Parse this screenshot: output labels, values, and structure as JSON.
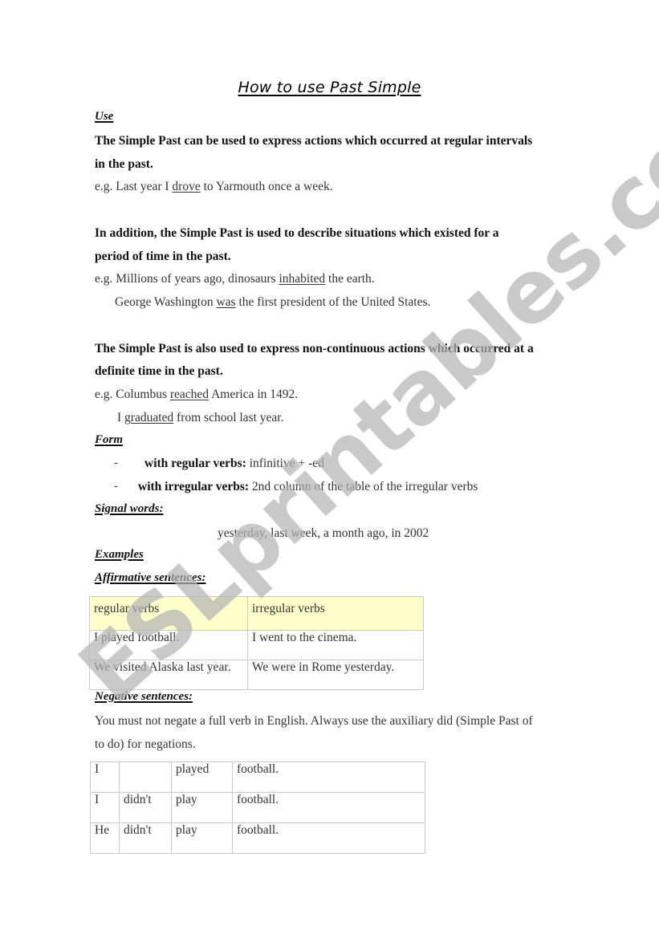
{
  "document": {
    "title": "How to use Past Simple",
    "sections": {
      "use": {
        "heading": "Use",
        "rule1": {
          "lines": [
            "The Simple Past can be used to express actions which occurred at regular intervals",
            "in the past."
          ],
          "example": {
            "prefix": "e.g. Last year I ",
            "verb": "drove",
            "suffix": " to Yarmouth once a week."
          }
        },
        "rule2": {
          "lines": [
            "In addition, the Simple Past is used to describe situations which existed for a",
            "period of time in the past."
          ],
          "examples": [
            {
              "prefix": "e.g. Millions of years ago, dinosaurs ",
              "verb": "inhabited",
              "suffix": " the earth."
            },
            {
              "prefix": "George Washington ",
              "verb": "was",
              "suffix": " the first president of the United States."
            }
          ]
        },
        "rule3": {
          "lines": [
            "The Simple Past is also used to express non-continuous actions which occurred at a",
            "definite time in the past."
          ],
          "examples": [
            {
              "prefix": "e.g. Columbus ",
              "verb": "reached",
              "suffix": " America in 1492."
            },
            {
              "prefix": "I ",
              "verb": "graduated",
              "suffix": " from school last year."
            }
          ]
        }
      },
      "form": {
        "heading": "Form",
        "items": [
          {
            "bullet": "-",
            "label": "with regular verbs:",
            "text": " infinitive + -ed"
          },
          {
            "bullet": "-",
            "label": "with irregular verbs:",
            "text": " 2nd column of the table of the irregular verbs"
          }
        ]
      },
      "signal_words": {
        "heading": "Signal words:",
        "text": "yesterday, last week, a month ago, in 2002"
      },
      "examples": {
        "heading": "Examples",
        "affirmative": {
          "heading": "Affirmative sentences:",
          "header": [
            "regular verbs",
            "irregular verbs"
          ],
          "rows": [
            [
              "I played football.",
              "I went to the cinema."
            ],
            [
              "We visited Alaska last year.",
              "We were in Rome yesterday."
            ]
          ],
          "header_color": "#ffffcc"
        },
        "negative": {
          "heading": "Negative sentences:",
          "lines": [
            "You must not negate a full verb in English. Always use the auxiliary did (Simple Past of",
            "to do) for negations."
          ],
          "rows": [
            [
              "I",
              "",
              "played",
              "football."
            ],
            [
              "I",
              "didn't",
              "play",
              "football."
            ],
            [
              "He",
              "didn't",
              "play",
              "football."
            ]
          ]
        }
      }
    }
  },
  "watermark": {
    "text": "ESLprintables.com",
    "color": "#c8c8c8"
  }
}
